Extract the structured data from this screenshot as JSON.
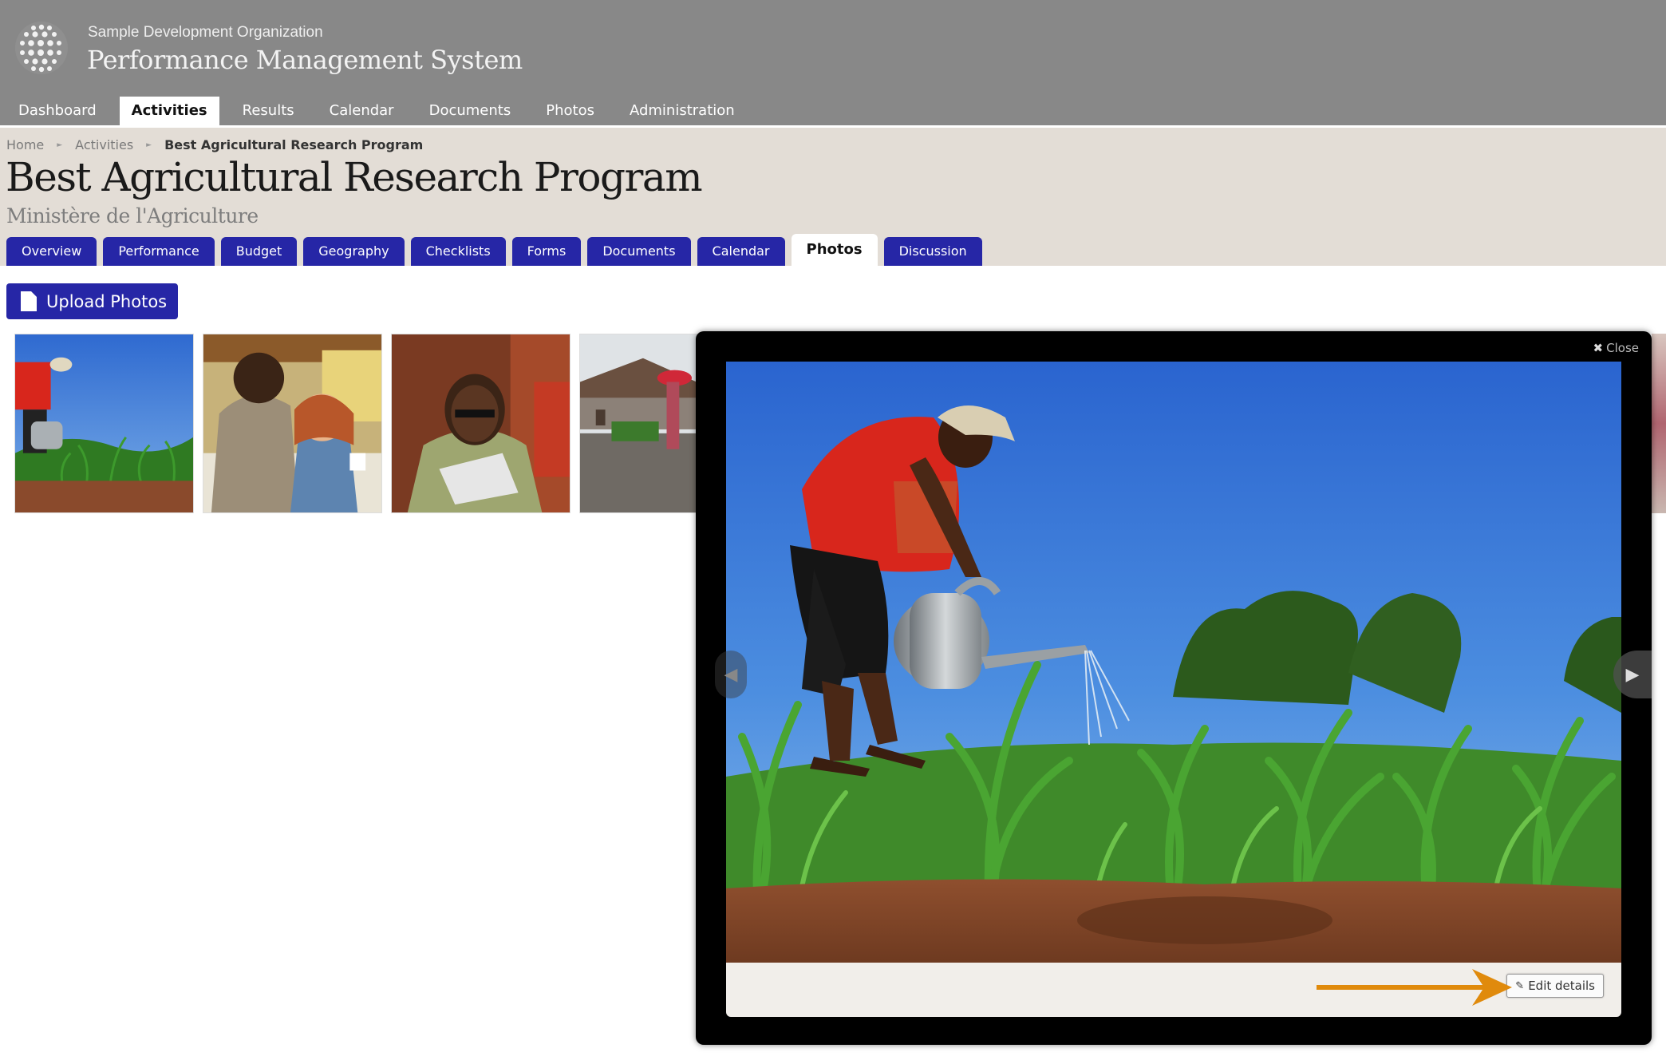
{
  "header": {
    "org_name": "Sample Development Organization",
    "system_name": "Performance Management System"
  },
  "main_nav": [
    {
      "label": "Dashboard",
      "active": false
    },
    {
      "label": "Activities",
      "active": true
    },
    {
      "label": "Results",
      "active": false
    },
    {
      "label": "Calendar",
      "active": false
    },
    {
      "label": "Documents",
      "active": false
    },
    {
      "label": "Photos",
      "active": false
    },
    {
      "label": "Administration",
      "active": false
    }
  ],
  "breadcrumb": {
    "home": "Home",
    "activities": "Activities",
    "current": "Best Agricultural Research Program"
  },
  "page": {
    "title": "Best Agricultural Research Program",
    "subtitle": "Ministère de l'Agriculture"
  },
  "tabs": [
    {
      "label": "Overview",
      "active": false
    },
    {
      "label": "Performance",
      "active": false
    },
    {
      "label": "Budget",
      "active": false
    },
    {
      "label": "Geography",
      "active": false
    },
    {
      "label": "Checklists",
      "active": false
    },
    {
      "label": "Forms",
      "active": false
    },
    {
      "label": "Documents",
      "active": false
    },
    {
      "label": "Calendar",
      "active": false
    },
    {
      "label": "Photos",
      "active": true
    },
    {
      "label": "Discussion",
      "active": false
    }
  ],
  "photos": {
    "upload_label": "Upload Photos"
  },
  "lightbox": {
    "close_label": "Close",
    "edit_label": "Edit details"
  },
  "colors": {
    "header_bg": "#888888",
    "title_band_bg": "#e3ddd6",
    "accent_blue": "#2626a6",
    "annotation_orange": "#e08a0c"
  }
}
